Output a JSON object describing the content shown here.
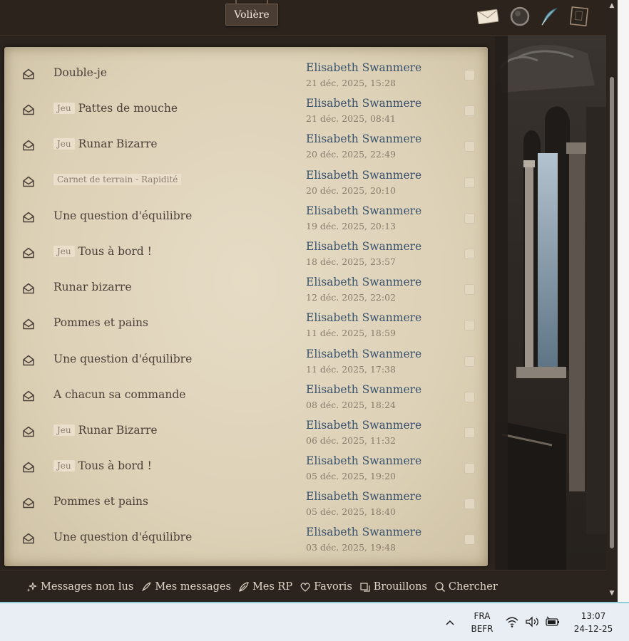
{
  "app": {
    "title": "Volière",
    "top_icons": [
      "envelope-icon",
      "orb-icon",
      "quill-icon",
      "book-icon"
    ]
  },
  "messages": [
    {
      "tag": "",
      "subject": "Double-je",
      "author": "Elisabeth Swanmere",
      "date": "21 déc. 2025, 15:28"
    },
    {
      "tag": "Jeu",
      "subject": "Pattes de mouche",
      "author": "Elisabeth Swanmere",
      "date": "21 déc. 2025, 08:41"
    },
    {
      "tag": "Jeu",
      "subject": "Runar Bizarre",
      "author": "Elisabeth Swanmere",
      "date": "20 déc. 2025, 22:49"
    },
    {
      "tag": "Carnet de terrain - Rapidité",
      "subject": "",
      "author": "Elisabeth Swanmere",
      "date": "20 déc. 2025, 20:10"
    },
    {
      "tag": "",
      "subject": "Une question d'équilibre",
      "author": "Elisabeth Swanmere",
      "date": "19 déc. 2025, 20:13"
    },
    {
      "tag": "Jeu",
      "subject": "Tous à bord !",
      "author": "Elisabeth Swanmere",
      "date": "18 déc. 2025, 23:57"
    },
    {
      "tag": "",
      "subject": "Runar bizarre",
      "author": "Elisabeth Swanmere",
      "date": "12 déc. 2025, 22:02"
    },
    {
      "tag": "",
      "subject": "Pommes et pains",
      "author": "Elisabeth Swanmere",
      "date": "11 déc. 2025, 18:59"
    },
    {
      "tag": "",
      "subject": "Une question d'équilibre",
      "author": "Elisabeth Swanmere",
      "date": "11 déc. 2025, 17:38"
    },
    {
      "tag": "",
      "subject": "A chacun sa commande",
      "author": "Elisabeth Swanmere",
      "date": "08 déc. 2025, 18:24"
    },
    {
      "tag": "Jeu",
      "subject": "Runar Bizarre",
      "author": "Elisabeth Swanmere",
      "date": "06 déc. 2025, 11:32"
    },
    {
      "tag": "Jeu",
      "subject": "Tous à bord !",
      "author": "Elisabeth Swanmere",
      "date": "05 déc. 2025, 19:20"
    },
    {
      "tag": "",
      "subject": "Pommes et pains",
      "author": "Elisabeth Swanmere",
      "date": "05 déc. 2025, 18:40"
    },
    {
      "tag": "",
      "subject": "Une question d'équilibre",
      "author": "Elisabeth Swanmere",
      "date": "03 déc. 2025, 19:48"
    }
  ],
  "footer": {
    "links": [
      {
        "icon": "sparkles-icon",
        "label": "Messages non lus"
      },
      {
        "icon": "quill-icon",
        "label": "Mes messages"
      },
      {
        "icon": "feather-icon",
        "label": "Mes RP"
      },
      {
        "icon": "heart-icon",
        "label": "Favoris"
      },
      {
        "icon": "drafts-icon",
        "label": "Brouillons"
      },
      {
        "icon": "search-icon",
        "label": "Chercher"
      }
    ]
  },
  "taskbar": {
    "lang_line1": "FRA",
    "lang_line2": "BEFR",
    "time": "13:07",
    "date": "24-12-25"
  },
  "colors": {
    "parchment": "#ddd1b7",
    "author_blue": "#38526e",
    "frame_brown": "#2b231e"
  }
}
